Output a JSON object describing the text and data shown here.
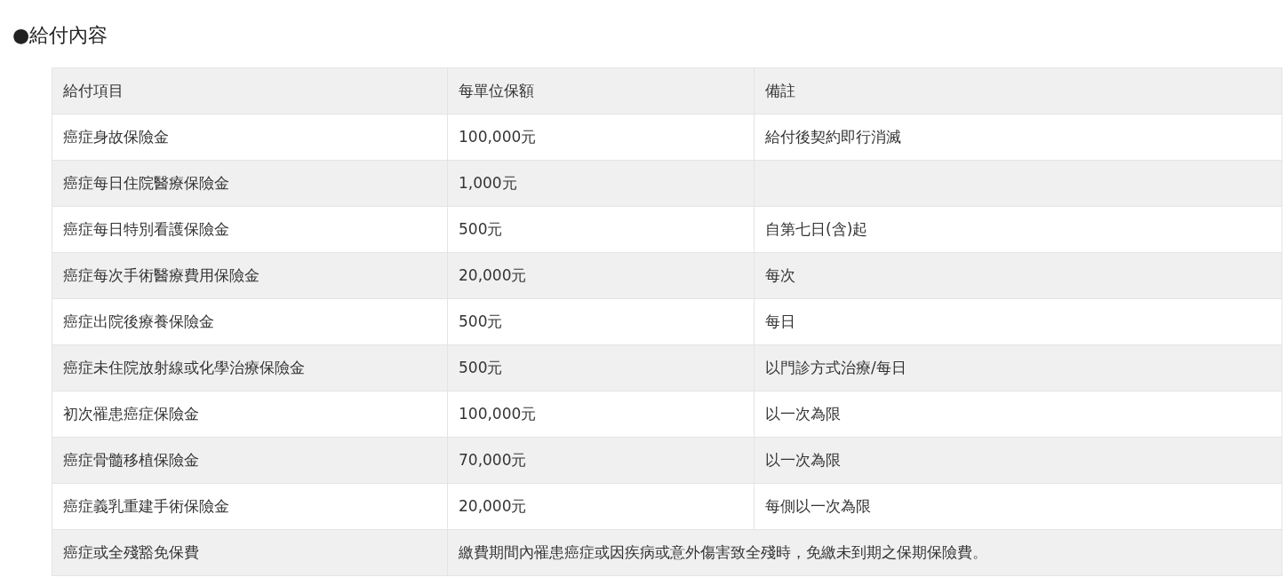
{
  "heading": "●給付內容",
  "table": {
    "columns": [
      "給付項目",
      "每單位保額",
      "備註"
    ],
    "rows": [
      {
        "cells": [
          "癌症身故保險金",
          "100,000元",
          "給付後契約即行消滅"
        ]
      },
      {
        "cells": [
          "癌症每日住院醫療保險金",
          "1,000元",
          ""
        ]
      },
      {
        "cells": [
          "癌症每日特別看護保險金",
          "500元",
          "自第七日(含)起"
        ]
      },
      {
        "cells": [
          "癌症每次手術醫療費用保險金",
          "20,000元",
          "每次"
        ]
      },
      {
        "cells": [
          "癌症出院後療養保險金",
          "500元",
          "每日"
        ]
      },
      {
        "cells": [
          "癌症未住院放射線或化學治療保險金",
          "500元",
          "以門診方式治療/每日"
        ]
      },
      {
        "cells": [
          "初次罹患癌症保險金",
          "100,000元",
          "以一次為限"
        ]
      },
      {
        "cells": [
          "癌症骨髓移植保險金",
          "70,000元",
          "以一次為限"
        ]
      },
      {
        "cells": [
          "癌症義乳重建手術保險金",
          "20,000元",
          "每側以一次為限"
        ]
      },
      {
        "cells": [
          "癌症或全殘豁免保費",
          {
            "text": "繳費期間內罹患癌症或因疾病或意外傷害致全殘時，免繳未到期之保期保險費。",
            "colspan": 2
          }
        ]
      }
    ]
  }
}
